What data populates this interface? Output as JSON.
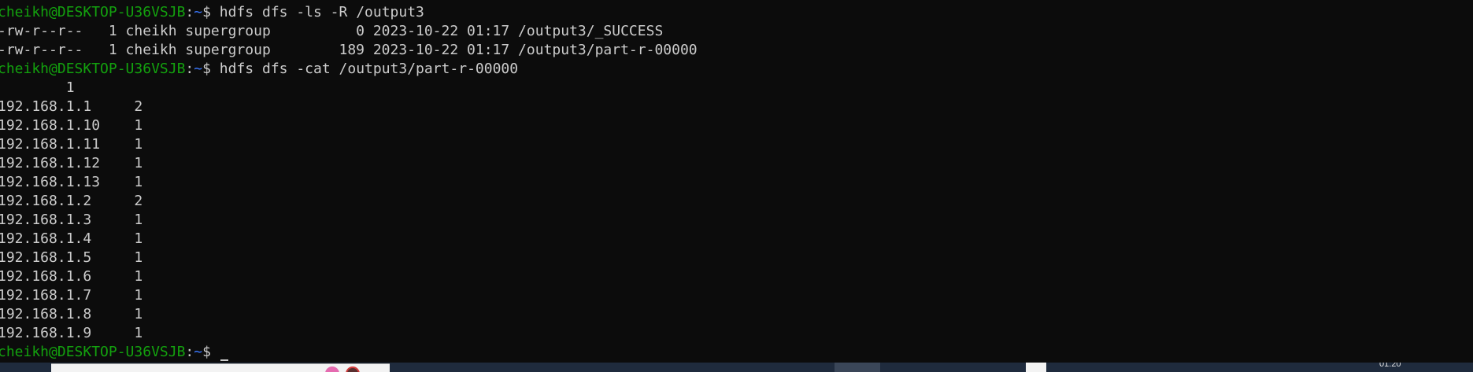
{
  "terminal": {
    "prompt": {
      "user_host": "cheikh@DESKTOP-U36VSJB",
      "separator": ":",
      "path": "~",
      "symbol": "$ "
    },
    "lines": [
      {
        "type": "prompt",
        "command": "hdfs dfs -ls -R /output3"
      },
      {
        "type": "output",
        "text": "-rw-r--r--   1 cheikh supergroup          0 2023-10-22 01:17 /output3/_SUCCESS"
      },
      {
        "type": "output",
        "text": "-rw-r--r--   1 cheikh supergroup        189 2023-10-22 01:17 /output3/part-r-00000"
      },
      {
        "type": "prompt",
        "command": "hdfs dfs -cat /output3/part-r-00000"
      },
      {
        "type": "output",
        "text": "        1"
      },
      {
        "type": "output",
        "text": "192.168.1.1     2"
      },
      {
        "type": "output",
        "text": "192.168.1.10    1"
      },
      {
        "type": "output",
        "text": "192.168.1.11    1"
      },
      {
        "type": "output",
        "text": "192.168.1.12    1"
      },
      {
        "type": "output",
        "text": "192.168.1.13    1"
      },
      {
        "type": "output",
        "text": "192.168.1.2     2"
      },
      {
        "type": "output",
        "text": "192.168.1.3     1"
      },
      {
        "type": "output",
        "text": "192.168.1.4     1"
      },
      {
        "type": "output",
        "text": "192.168.1.5     1"
      },
      {
        "type": "output",
        "text": "192.168.1.6     1"
      },
      {
        "type": "output",
        "text": "192.168.1.7     1"
      },
      {
        "type": "output",
        "text": "192.168.1.8     1"
      },
      {
        "type": "output",
        "text": "192.168.1.9     1"
      },
      {
        "type": "prompt",
        "command": "",
        "cursor": true
      }
    ]
  },
  "colors": {
    "background": "#0c0c0c",
    "text": "#cccccc",
    "user_host": "#13a10e",
    "path": "#3b78ff",
    "taskbar": "#1f2b3d"
  },
  "taskbar": {
    "clock": "01:20"
  }
}
